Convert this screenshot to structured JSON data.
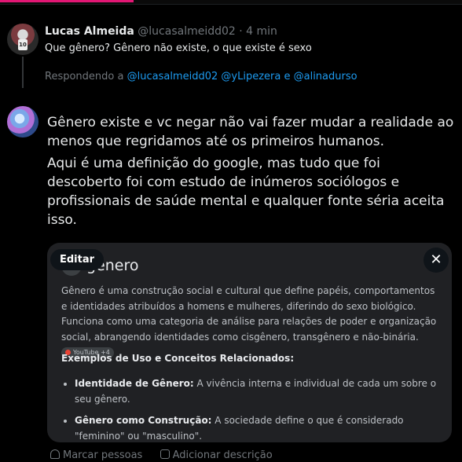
{
  "tweet": {
    "author_name": "Lucas Almeida",
    "author_handle": "@lucasalmeidd02",
    "separator": "·",
    "time": "4 min",
    "text": "Que gênero? Gênero não existe, o que existe é sexo",
    "avatar_jersey": "10",
    "replying_prefix": "Respondendo a",
    "replying_mentions": [
      "@lucasalmeidd02",
      "@yLipezera",
      "@alinadurso"
    ],
    "replying_conjunction": "e"
  },
  "reply": {
    "paragraphs": [
      "Gênero existe e vc negar não vai fazer mudar a realidade ao menos que regridamos até os primeiros humanos.",
      "Aqui é uma definição do google, mas tudo que foi descoberto foi com estudo de inúmeros sociólogos e profissionais de saúde mental e qualquer fonte séria aceita isso."
    ]
  },
  "attachment": {
    "edit_label": "Editar",
    "close_icon": "✕",
    "title": "gênero",
    "definition": "Gênero é uma construção social e cultural que define papéis, comportamentos e identidades atribuídos a homens e mulheres, diferindo do sexo biológico. Funciona como uma categoria de análise para relações de poder e organização social, abrangendo identidades como cisgênero, transgênero e não-binária.",
    "source_badge": "YouTube +4",
    "examples_title": "Exemplos de Uso e Conceitos Relacionados:",
    "examples": [
      {
        "term": "Identidade de Gênero:",
        "text": " A vivência interna e individual de cada um sobre o seu gênero."
      },
      {
        "term": "Gênero como Construção:",
        "text": " A sociedade define o que é considerado \"feminino\" ou \"masculino\"."
      }
    ]
  },
  "bottom_actions": {
    "tag_people": "Marcar pessoas",
    "add_description": "Adicionar descrição"
  },
  "colors": {
    "background": "#000000",
    "text": "#e7e9ea",
    "muted": "#71767b",
    "link": "#1d9bf0",
    "card": "#202124"
  }
}
